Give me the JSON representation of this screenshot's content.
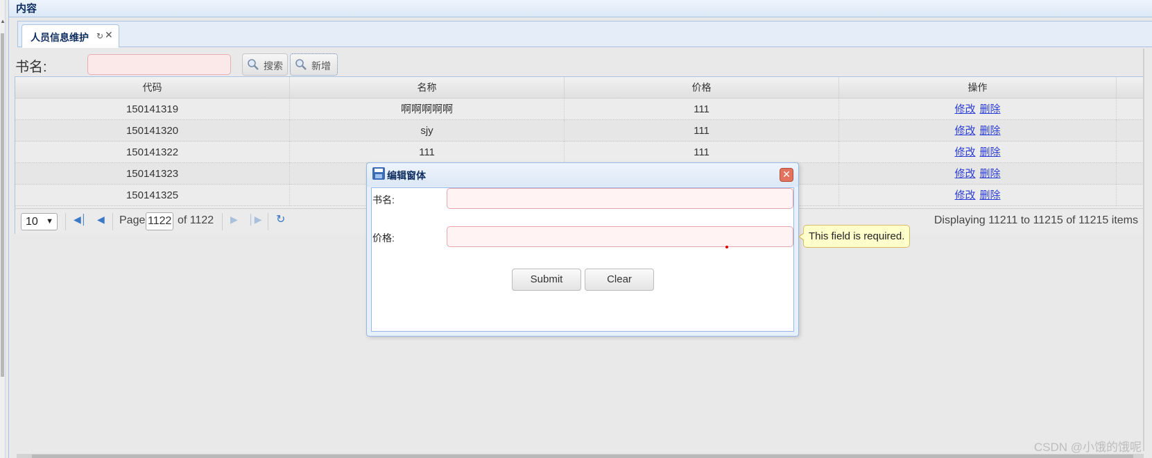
{
  "panel": {
    "title": "内容"
  },
  "tab": {
    "label": "人员信息维护",
    "refresh_icon": "refresh-icon",
    "close_icon": "close-icon"
  },
  "toolbar": {
    "label": "书名:",
    "input_value": "",
    "search_label": "搜索",
    "add_label": "新增",
    "search_icon": "magnifier-icon"
  },
  "grid": {
    "columns": [
      "代码",
      "名称",
      "价格",
      "操作"
    ],
    "rows": [
      {
        "code": "150141319",
        "name": "啊啊啊啊啊",
        "price": "111",
        "edit": "修改",
        "del": "删除"
      },
      {
        "code": "150141320",
        "name": "sjy",
        "price": "111",
        "edit": "修改",
        "del": "删除"
      },
      {
        "code": "150141322",
        "name": "111",
        "price": "111",
        "edit": "修改",
        "del": "删除"
      },
      {
        "code": "150141323",
        "name": "",
        "price": "",
        "edit": "修改",
        "del": "删除"
      },
      {
        "code": "150141325",
        "name": "",
        "price": "",
        "edit": "修改",
        "del": "删除"
      }
    ]
  },
  "pager": {
    "page_size": "10",
    "page_label": "Page",
    "page_value": "1122",
    "of_label": "of 1122",
    "info": "Displaying 11211 to 11215 of 11215 items"
  },
  "dialog": {
    "title": "编辑窗体",
    "field1_label": "书名:",
    "field2_label": "价格:",
    "submit_label": "Submit",
    "clear_label": "Clear",
    "tooltip": "This field is required."
  },
  "watermark": "CSDN @小饿的饿呢",
  "colors": {
    "accent_border": "#a8c4e2",
    "link": "#2c3dd6",
    "invalid_bg": "#fff3f3",
    "tooltip_bg": "#ffffcc"
  }
}
